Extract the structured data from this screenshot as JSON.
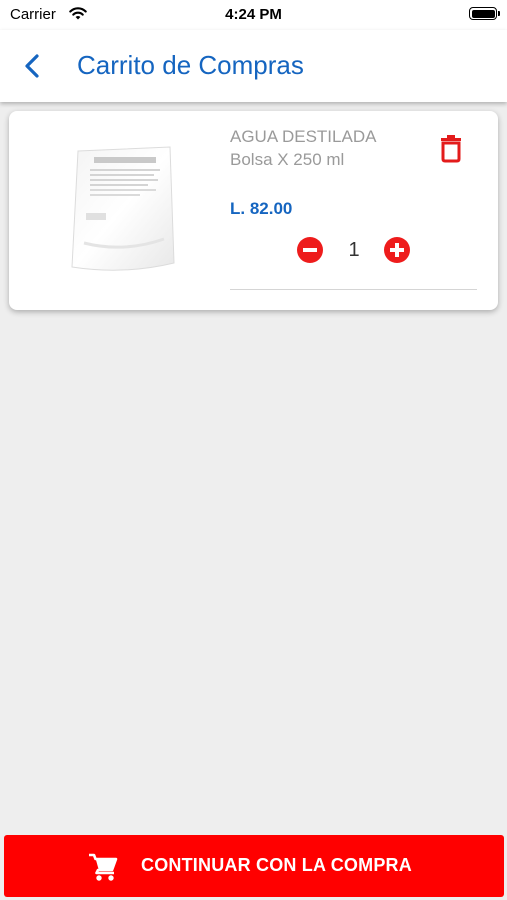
{
  "status_bar": {
    "carrier": "Carrier",
    "time": "4:24 PM"
  },
  "nav": {
    "title": "Carrito de Compras"
  },
  "cart_items": [
    {
      "name_line1": "AGUA DESTILADA",
      "name_line2": "Bolsa X 250 ml",
      "price": "L. 82.00",
      "quantity": "1",
      "image_label": "AGUA DESTILADA"
    }
  ],
  "checkout": {
    "label": "CONTINUAR CON LA COMPRA"
  },
  "colors": {
    "accent_blue": "#1565c0",
    "action_red": "#ff0000",
    "background": "#eeeeee"
  },
  "icons": [
    "wifi-icon",
    "battery-icon",
    "back-chevron-icon",
    "trash-icon",
    "minus-circle-icon",
    "plus-circle-icon",
    "cart-icon"
  ]
}
